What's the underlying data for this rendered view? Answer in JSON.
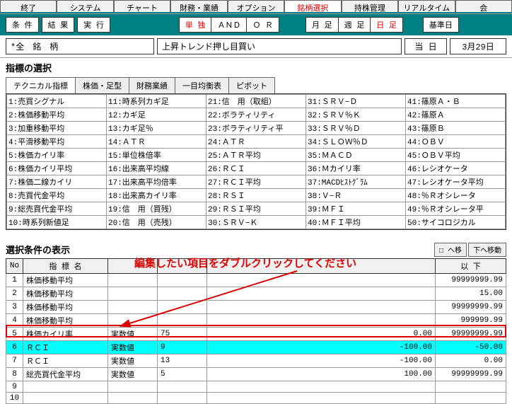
{
  "menubar": [
    "終了",
    "システム",
    "チャート",
    "財務・業績",
    "オプション",
    "銘柄選択",
    "持株管理",
    "リアルタイム",
    "会"
  ],
  "menubar_active": 5,
  "toolbar1": {
    "left": [
      "条 件",
      "結 果",
      "実 行"
    ],
    "mid": [
      {
        "t": "単 独",
        "red": true
      },
      {
        "t": "ＡＮＤ"
      },
      {
        "t": "Ｏ Ｒ"
      }
    ],
    "right1": [
      {
        "t": "月 足"
      },
      {
        "t": "週 足"
      },
      {
        "t": "日 足",
        "red": true
      }
    ],
    "right2": [
      {
        "t": "基準日"
      }
    ]
  },
  "inforow": {
    "stock": "*全　銘　柄",
    "strategy": "上昇トレンド押し目買い",
    "day_label": "当 日",
    "date": "3月29日"
  },
  "section1_title": "指標の選択",
  "subtabs": [
    "テクニカル指標",
    "株価・足型",
    "財務業績",
    "一目均衡表",
    "ピボット"
  ],
  "subtab_active": 0,
  "indicators": [
    [
      "1:売買シグナル",
      "11:時系列カギ足",
      "21:信　用（取組）",
      "31:ＳＲＶ−Ｄ",
      "41:篠原Ａ・Ｂ"
    ],
    [
      "2:株価移動平均",
      "12:カギ足",
      "22:ボラティリティ",
      "32:ＳＲＶ％Ｋ",
      "42:篠原Ａ"
    ],
    [
      "3:加重移動平均",
      "13:カギ足％",
      "23:ボラティリティ平",
      "33:ＳＲＶ％Ｄ",
      "43:篠原Ｂ"
    ],
    [
      "4:平滑移動平均",
      "14:ＡＴＲ",
      "24:ＡＴＲ",
      "34:ＳＬＯＷ％Ｄ",
      "44:ＯＢＶ"
    ],
    [
      "5:株価カイリ率",
      "15:単位株倍率",
      "25:ＡＴＲ平均",
      "35:ＭＡＣＤ",
      "45:ＯＢＶ平均"
    ],
    [
      "6:株価カイリ平均",
      "16:出来高平均線",
      "26:ＲＣＩ",
      "36:Ｍカイリ率",
      "46:レシオケータ"
    ],
    [
      "7:株価二線カイリ",
      "17:出来高平均倍率",
      "27:ＲＣＩ平均",
      "37:MACDﾋｽﾄｸﾞﾗﾑ",
      "47:レシオケータ平均"
    ],
    [
      "8:売買代金平均",
      "18:出来高カイリ率",
      "28:ＲＳＩ",
      "38:Ｖ−Ｒ",
      "48:％Ｒオシレータ"
    ],
    [
      "9:総売買代金平均",
      "19:信　用（買残）",
      "29:ＲＳＩ平均",
      "39:ＭＦＩ",
      "49:％Ｒオシレータ平"
    ],
    [
      "10:時系列新値足",
      "20:信　用（売残）",
      "30:ＳＲＶ−Ｋ",
      "40:ＭＦＩ平均",
      "50:サイコロジカル"
    ]
  ],
  "section2_title": "選択条件の表示",
  "move_btns": [
    "□ ヘ移",
    "下ヘ移動"
  ],
  "instruction_text": "編集したい項目をダブルクリックしてください",
  "cond_headers": [
    "No",
    "指 標 名",
    "",
    "",
    "",
    "以 下"
  ],
  "cond_header_extra": "",
  "conditions": [
    {
      "no": "1",
      "name": "株価移動平均",
      "type": "",
      "v1": "",
      "v2": "",
      "v3": "99999999.99"
    },
    {
      "no": "2",
      "name": "株価移動平均",
      "type": "",
      "v1": "",
      "v2": "",
      "v3": "15.00"
    },
    {
      "no": "3",
      "name": "株価移動平均",
      "type": "",
      "v1": "",
      "v2": "",
      "v3": "99999999.99"
    },
    {
      "no": "4",
      "name": "株価移動平均",
      "type": "",
      "v1": "",
      "v2": "",
      "v3": "999999.99"
    },
    {
      "no": "5",
      "name": "株価カイリ率",
      "type": "実数値",
      "v1": "75",
      "v2": "0.00",
      "v3": "99999999.99"
    },
    {
      "no": "6",
      "name": "ＲＣＩ",
      "type": "実数値",
      "v1": "9",
      "v2": "-100.00",
      "v3": "-50.00",
      "hl": true
    },
    {
      "no": "7",
      "name": "ＲＣＩ",
      "type": "実数値",
      "v1": "13",
      "v2": "-100.00",
      "v3": "0.00"
    },
    {
      "no": "8",
      "name": "総売買代金平均",
      "type": "実数値",
      "v1": "5",
      "v2": "100.00",
      "v3": "99999999.99"
    },
    {
      "no": "9",
      "name": "",
      "type": "",
      "v1": "",
      "v2": "",
      "v3": ""
    },
    {
      "no": "10",
      "name": "",
      "type": "",
      "v1": "",
      "v2": "",
      "v3": ""
    }
  ]
}
